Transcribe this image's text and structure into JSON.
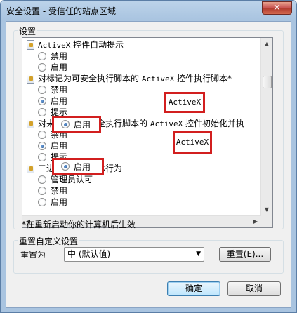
{
  "window": {
    "title": "安全设置 - 受信任的站点区域",
    "close_glyph": "✕"
  },
  "settings_group": {
    "label": "设置"
  },
  "list": {
    "items": [
      {
        "kind": "header",
        "text_prefix": "",
        "text_code": "ActiveX",
        "text_suffix": " 控件自动提示"
      },
      {
        "kind": "option",
        "text": "禁用",
        "selected": false
      },
      {
        "kind": "option",
        "text": "启用",
        "selected": false
      },
      {
        "kind": "header",
        "text_prefix": "对标记为可安全执行脚本的 ",
        "text_code": "ActiveX",
        "text_suffix": " 控件执行脚本*"
      },
      {
        "kind": "option",
        "text": "禁用",
        "selected": false
      },
      {
        "kind": "option",
        "text": "启用",
        "selected": true
      },
      {
        "kind": "option",
        "text": "提示",
        "selected": false
      },
      {
        "kind": "header",
        "text_prefix": "对未标记为可安全执行脚本的 ",
        "text_code": "ActiveX",
        "text_suffix": " 控件初始化并执"
      },
      {
        "kind": "option",
        "text": "禁用",
        "selected": false
      },
      {
        "kind": "option",
        "text": "启用",
        "selected": true
      },
      {
        "kind": "option",
        "text": "提示",
        "selected": false
      },
      {
        "kind": "header",
        "text_prefix": "二进制文件和脚本行为",
        "text_code": "",
        "text_suffix": ""
      },
      {
        "kind": "option",
        "text": "管理员认可",
        "selected": false
      },
      {
        "kind": "option",
        "text": "禁用",
        "selected": false
      },
      {
        "kind": "option",
        "text": "启用",
        "selected": false
      }
    ]
  },
  "callouts": {
    "activex_1": "ActiveX",
    "enable_1": "启用",
    "activex_2": "ActiveX",
    "enable_2": "启用"
  },
  "note": "*在重新启动你的计算机后生效",
  "reset_group": {
    "label": "重置自定义设置",
    "reset_to_label": "重置为",
    "select_value": "中 (默认值)",
    "reset_button": "重置(E)..."
  },
  "footer": {
    "ok": "确定",
    "cancel": "取消"
  }
}
